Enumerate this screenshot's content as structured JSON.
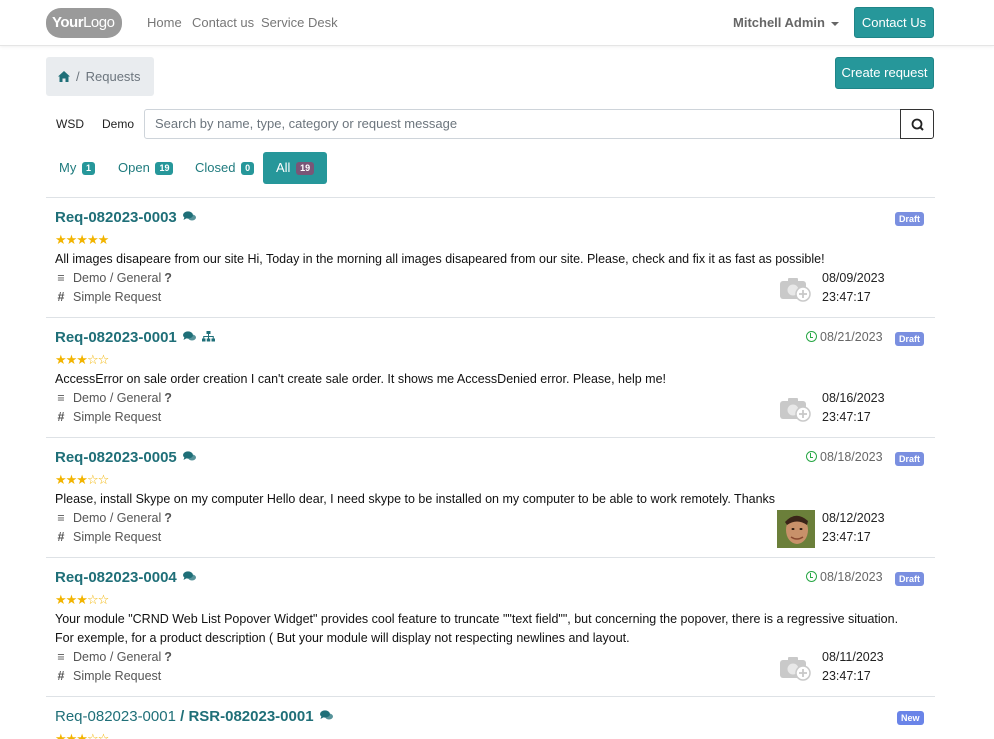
{
  "navbar": {
    "logo_text": "YourLogo",
    "logo_bold": "Your",
    "logo_rest": "Logo",
    "links": [
      "Home",
      "Contact us",
      "Service Desk"
    ],
    "user": "Mitchell Admin",
    "contact_button": "Contact Us"
  },
  "breadcrumb": {
    "current": "Requests",
    "separator": "/"
  },
  "create_button": "Create request",
  "search": {
    "chips": [
      "WSD",
      "Demo"
    ],
    "placeholder": "Search by name, type, category or request message"
  },
  "tabs": [
    {
      "label": "My",
      "count": "1"
    },
    {
      "label": "Open",
      "count": "19"
    },
    {
      "label": "Closed",
      "count": "0"
    },
    {
      "label": "All",
      "count": "19",
      "active": true
    }
  ],
  "requests": [
    {
      "name": "Req-082023-0003",
      "rating": 5,
      "stage": "Draft",
      "deadline": "",
      "text": "All images disapeare from our site Hi, Today in the morning all images disapeared from our site. Please, check and fix it as fast as possible!",
      "category": "Demo / General",
      "type": "Simple Request",
      "date": "08/09/2023",
      "time": "23:47:17"
    },
    {
      "name": "Req-082023-0001",
      "rating": 3,
      "stage": "Draft",
      "deadline": "08/21/2023",
      "text": "AccessError on sale order creation I can't create sale order. It shows me AccessDenied error. Please, help me!",
      "category": "Demo / General",
      "type": "Simple Request",
      "date": "08/16/2023",
      "time": "23:47:17"
    },
    {
      "name": "Req-082023-0005",
      "rating": 3,
      "stage": "Draft",
      "deadline": "08/18/2023",
      "text": "Please, install Skype on my computer Hello dear, I need skype to be installed on my computer to be able to work remotely. Thanks",
      "category": "Demo / General",
      "type": "Simple Request",
      "date": "08/12/2023",
      "time": "23:47:17"
    },
    {
      "name": "Req-082023-0004",
      "rating": 3,
      "stage": "Draft",
      "deadline": "08/18/2023",
      "text_line1": "Your module \"CRND Web List Popover Widget\" provides cool feature to truncate \"\"text field\"\", but concerning the popover, there is a regressive situation.",
      "text_line2": "For exemple, for a product description ( But your module will display not respecting newlines and layout.",
      "category": "Demo / General",
      "type": "Simple Request",
      "date": "08/11/2023",
      "time": "23:47:17"
    },
    {
      "name_parent": "Req-082023-0001",
      "name": "RSR-082023-0001",
      "stage": "New"
    }
  ],
  "colors": {
    "accent": "#26979a",
    "link": "#1f6f78",
    "star": "#f2b400",
    "draft": "#7a8fe0"
  }
}
